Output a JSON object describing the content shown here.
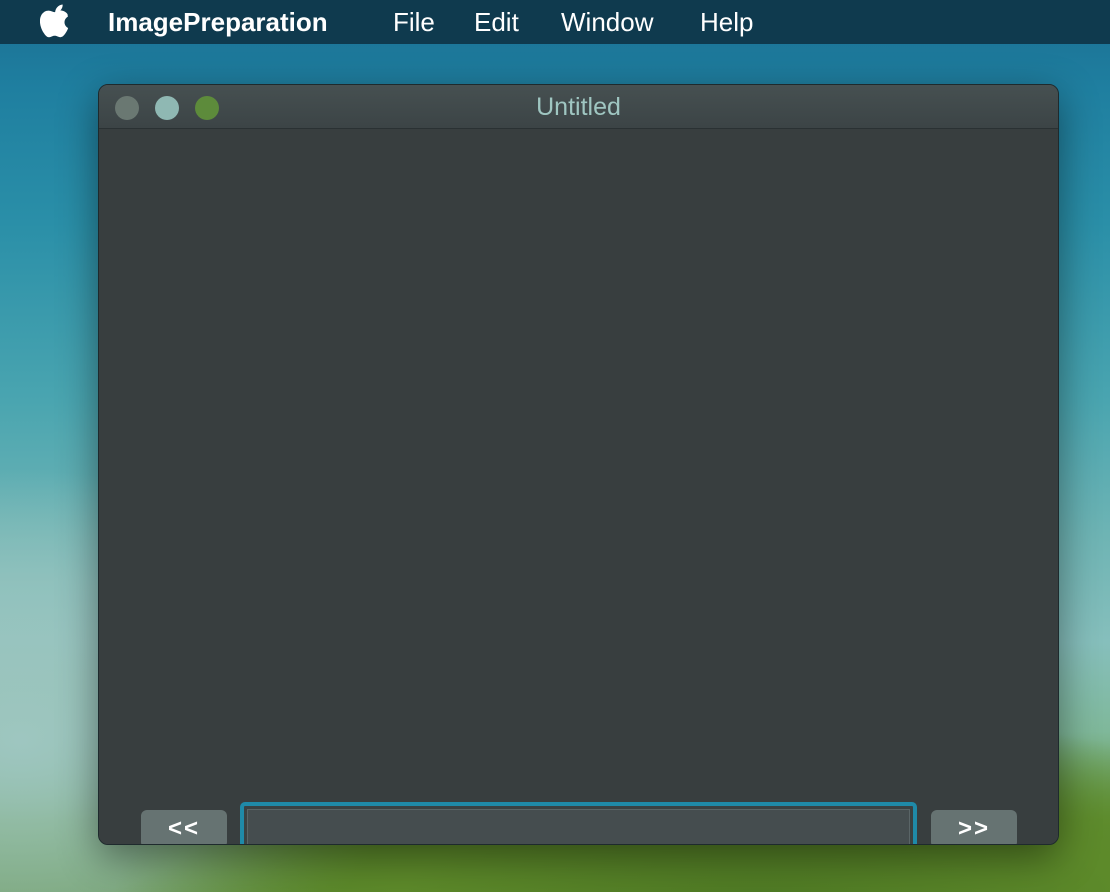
{
  "menubar": {
    "apple_icon": "apple-logo-icon",
    "app_name": "ImagePreparation",
    "items": [
      "File",
      "Edit",
      "Window",
      "Help"
    ]
  },
  "window": {
    "title": "Untitled",
    "controls": {
      "close_color": "#6a7872",
      "minimize_color": "#8fb8b3",
      "zoom_color": "#5d8b3b"
    },
    "prev_button_label": "<<",
    "next_button_label": ">>",
    "text_field": {
      "value": "",
      "placeholder": "",
      "focus_ring_color": "#1f8aa8"
    }
  }
}
